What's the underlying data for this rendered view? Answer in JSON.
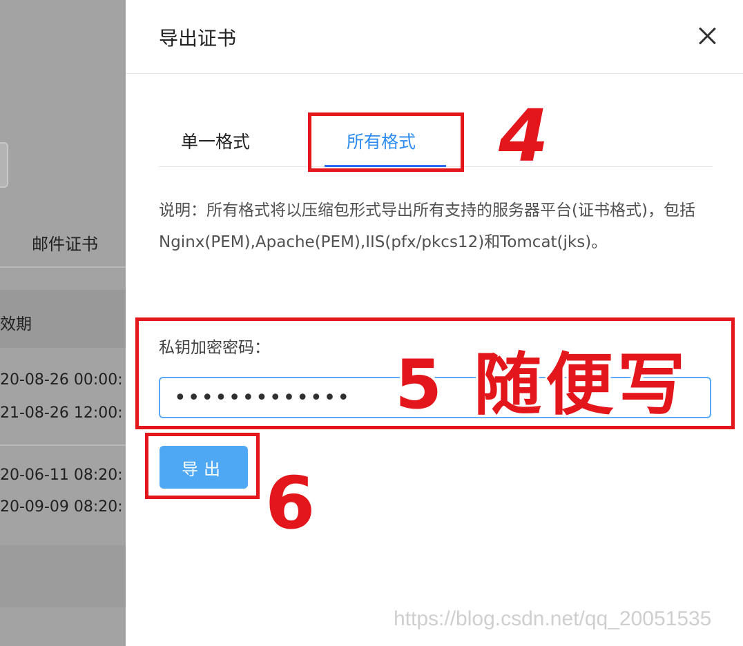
{
  "background": {
    "tab_label": "邮件证书",
    "column_header": "效期",
    "rows": [
      [
        "20-08-26 00:00:",
        "21-08-26 12:00:"
      ],
      [
        "20-06-11 08:20:",
        "20-09-09 08:20:"
      ]
    ]
  },
  "drawer": {
    "title": "导出证书",
    "tabs": [
      {
        "label": "单一格式",
        "active": false
      },
      {
        "label": "所有格式",
        "active": true
      }
    ],
    "description": "说明：所有格式将以压缩包形式导出所有支持的服务器平台(证书格式)，包括Nginx(PEM),Apache(PEM),IIS(pfx/pkcs12)和Tomcat(jks)。",
    "password_label": "私钥加密密码：",
    "password_value": "•••••••••••••",
    "export_label": "导出"
  },
  "annotations": {
    "step4": "4",
    "step5": "5 随便写",
    "step6": "6",
    "color": "#e3161b"
  },
  "watermark": "https://blog.csdn.net/qq_20051535",
  "colors": {
    "accent": "#2d8cf0",
    "button": "#4fa8f3",
    "overlay": "#9a9a9a"
  }
}
